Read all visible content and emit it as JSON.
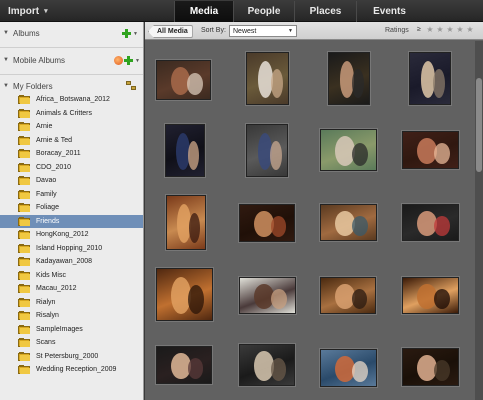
{
  "topbar": {
    "import_label": "Import",
    "tabs": [
      {
        "label": "Media",
        "active": true
      },
      {
        "label": "People",
        "active": false
      },
      {
        "label": "Places",
        "active": false
      },
      {
        "label": "Events",
        "active": false
      }
    ]
  },
  "left_panel": {
    "albums_label": "Albums",
    "mobile_albums_label": "Mobile Albums",
    "my_folders_label": "My Folders",
    "folders": [
      "Africa_ Botswana_2012",
      "Animals & Critters",
      "Arnie",
      "Arnie & Ted",
      "Boracay_2011",
      "CDO_2010",
      "Davao",
      "Family",
      "Foliage",
      "Friends",
      "HongKong_2012",
      "Island Hopping_2010",
      "Kadayawan_2008",
      "Kids Misc",
      "Macau_2012",
      "Rialyn",
      "Risalyn",
      "SampleImages",
      "Scans",
      "St Petersburg_2000",
      "Wedding Reception_2009"
    ],
    "selected_folder": "Friends"
  },
  "filter_bar": {
    "all_media_label": "All Media",
    "sort_by_label": "Sort By:",
    "sort_value": "Newest",
    "ratings_label": "Ratings",
    "ratings_operator": "≥",
    "stars": [
      "★",
      "★",
      "★",
      "★",
      "★"
    ]
  },
  "colors": {
    "accent_selected": "#6f8fb8",
    "add_green": "#2fa31f",
    "grid_bg": "#616161",
    "folder_yellow": "#f0c842"
  },
  "photos": [
    {
      "name": "photo-1",
      "colors": [
        "#3b2a20",
        "#a86a4a",
        "#d8c8b8",
        "#5a3a2a"
      ]
    },
    {
      "name": "photo-2",
      "colors": [
        "#4a3a2a",
        "#e8e0d8",
        "#c8a888",
        "#6a5a3a"
      ]
    },
    {
      "name": "photo-3",
      "colors": [
        "#1a1a1a",
        "#c89a7a",
        "#2a2a2a",
        "#3a3020"
      ]
    },
    {
      "name": "photo-4",
      "colors": [
        "#2a2a3a",
        "#e0c8a8",
        "#8a7a6a",
        "#1a1a2a"
      ]
    },
    {
      "name": "photo-5",
      "colors": [
        "#202030",
        "#2a3a6a",
        "#d0a888",
        "#101018"
      ]
    },
    {
      "name": "photo-6",
      "colors": [
        "#383838",
        "#3a4a7a",
        "#c8a890",
        "#5a5a5a"
      ]
    },
    {
      "name": "photo-7",
      "colors": [
        "#5a7a5a",
        "#d8c8b8",
        "#2a2a2a",
        "#8a9a6a"
      ]
    },
    {
      "name": "photo-8",
      "colors": [
        "#402018",
        "#c87a5a",
        "#e8b898",
        "#301810"
      ]
    },
    {
      "name": "photo-9",
      "colors": [
        "#7a3a1a",
        "#e0a060",
        "#3a1a10",
        "#c88a50"
      ]
    },
    {
      "name": "photo-10",
      "colors": [
        "#301a10",
        "#d09060",
        "#a04a2a",
        "#201008"
      ]
    },
    {
      "name": "photo-11",
      "colors": [
        "#5a3a20",
        "#e8c8a0",
        "#3a5a6a",
        "#a06a40"
      ]
    },
    {
      "name": "photo-12",
      "colors": [
        "#1a1a1a",
        "#d89a7a",
        "#c03a3a",
        "#2a2a2a"
      ]
    },
    {
      "name": "photo-13",
      "colors": [
        "#502810",
        "#e0a060",
        "#2a1408",
        "#c07030"
      ]
    },
    {
      "name": "photo-14",
      "colors": [
        "#e0e0d8",
        "#5a3a2a",
        "#c8a080",
        "#4a3a3a"
      ]
    },
    {
      "name": "photo-15",
      "colors": [
        "#4a2a10",
        "#d8a070",
        "#2a1a10",
        "#a87040"
      ]
    },
    {
      "name": "photo-16",
      "colors": [
        "#3a1a08",
        "#c07030",
        "#1a0a04",
        "#e0a060"
      ]
    },
    {
      "name": "photo-17",
      "colors": [
        "#1a1a1a",
        "#e0b898",
        "#5a3a3a",
        "#2a2020"
      ]
    },
    {
      "name": "photo-18",
      "colors": [
        "#3a3a3a",
        "#d8c8b0",
        "#6a5a4a",
        "#1a1a1a"
      ]
    },
    {
      "name": "photo-19",
      "colors": [
        "#5a7a9a",
        "#d06a3a",
        "#e8d8c8",
        "#2a4a6a"
      ]
    },
    {
      "name": "photo-20",
      "colors": [
        "#2a1a10",
        "#e0b090",
        "#4a3a2a",
        "#1a1008"
      ]
    }
  ]
}
